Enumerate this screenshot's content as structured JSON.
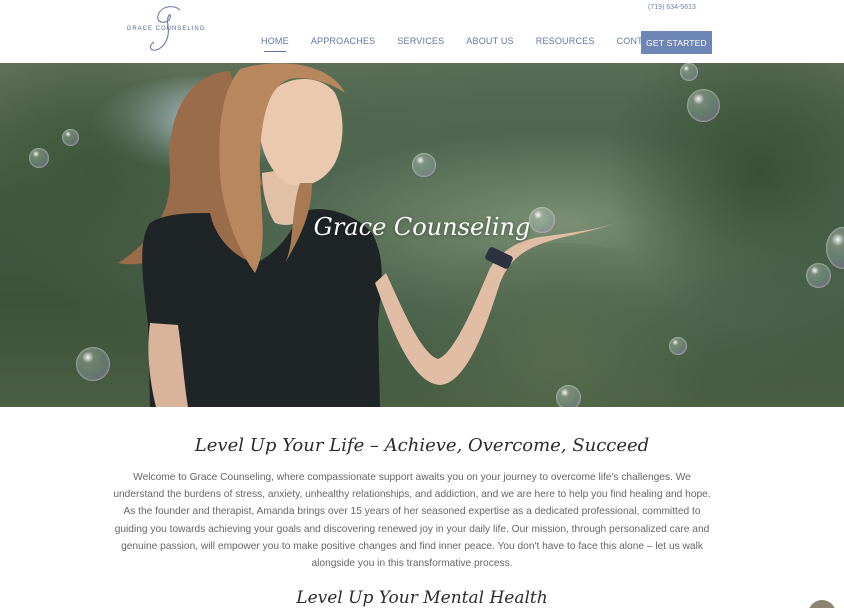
{
  "header": {
    "logo_text": "GRACE COUNSELING",
    "phone": "(719) 634-5613",
    "nav": [
      {
        "label": "HOME",
        "active": true
      },
      {
        "label": "APPROACHES",
        "active": false
      },
      {
        "label": "SERVICES",
        "active": false
      },
      {
        "label": "ABOUT US",
        "active": false
      },
      {
        "label": "RESOURCES",
        "active": false
      },
      {
        "label": "CONTACT",
        "active": false
      }
    ],
    "cta_label": "GET STARTED"
  },
  "hero": {
    "title": "Grace Counseling"
  },
  "main": {
    "heading": "Level Up Your Life – Achieve, Overcome, Succeed",
    "paragraph": "Welcome to Grace Counseling, where compassionate support awaits you on your journey to overcome life's challenges. We understand the burdens of stress, anxiety, unhealthy relationships, and addiction, and we are here to help you find healing and hope. As the founder and therapist, Amanda brings over 15 years of her seasoned expertise as a dedicated professional, committed to guiding you towards achieving your goals and discovering renewed joy in your daily life. Our mission, through personalized care and genuine passion, will empower you to make positive changes and find inner peace. You don't have to face this alone – let us walk alongside you in this transformative process.",
    "subheading": "Level Up Your Mental Health"
  },
  "colors": {
    "brand": "#6e86b5",
    "nav_text": "#5f77a8",
    "scroll_button": "#8d8572"
  }
}
